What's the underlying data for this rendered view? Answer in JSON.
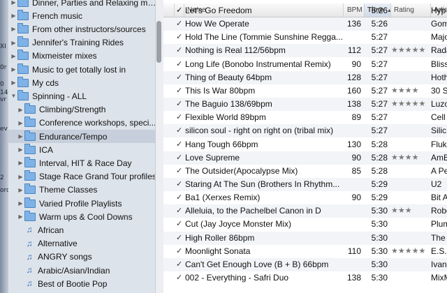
{
  "bg_fragments": [
    "XI",
    "0r",
    "0",
    "14",
    "vr",
    "ev",
    "2",
    "ord"
  ],
  "sidebar": {
    "items": [
      {
        "label": "Dinner, Parties and Relaxing music",
        "kind": "folder",
        "indent": 0,
        "disclosure": "▶",
        "selected": false
      },
      {
        "label": "French music",
        "kind": "folder",
        "indent": 0,
        "disclosure": "▶",
        "selected": false
      },
      {
        "label": "From other instructors/sources",
        "kind": "folder",
        "indent": 0,
        "disclosure": "▶",
        "selected": false
      },
      {
        "label": "Jennifer's Training Rides",
        "kind": "folder",
        "indent": 0,
        "disclosure": "▶",
        "selected": false
      },
      {
        "label": "Mixmeister mixes",
        "kind": "folder",
        "indent": 0,
        "disclosure": "▶",
        "selected": false
      },
      {
        "label": "Music to get totally lost in",
        "kind": "folder",
        "indent": 0,
        "disclosure": "▶",
        "selected": false
      },
      {
        "label": "My cds",
        "kind": "folder",
        "indent": 0,
        "disclosure": "▶",
        "selected": false
      },
      {
        "label": "Spinning - ALL",
        "kind": "folder",
        "indent": 0,
        "disclosure": "▼",
        "selected": false
      },
      {
        "label": "Climbing/Strength",
        "kind": "folder",
        "indent": 1,
        "disclosure": "▶",
        "selected": false
      },
      {
        "label": "Conference workshops, speci...",
        "kind": "folder",
        "indent": 1,
        "disclosure": "▶",
        "selected": false
      },
      {
        "label": "Endurance/Tempo",
        "kind": "folder",
        "indent": 1,
        "disclosure": "▶",
        "selected": true
      },
      {
        "label": "ICA",
        "kind": "folder",
        "indent": 1,
        "disclosure": "▶",
        "selected": false
      },
      {
        "label": "Interval, HIT & Race Day",
        "kind": "folder",
        "indent": 1,
        "disclosure": "▶",
        "selected": false
      },
      {
        "label": "Stage Race Grand Tour profiles",
        "kind": "folder",
        "indent": 1,
        "disclosure": "▶",
        "selected": false
      },
      {
        "label": "Theme Classes",
        "kind": "folder",
        "indent": 1,
        "disclosure": "▶",
        "selected": false
      },
      {
        "label": "Varied Profile Playlists",
        "kind": "folder",
        "indent": 1,
        "disclosure": "▶",
        "selected": false
      },
      {
        "label": "Warm ups & Cool Downs",
        "kind": "folder",
        "indent": 1,
        "disclosure": "▶",
        "selected": false
      },
      {
        "label": "African",
        "kind": "playlist",
        "indent": 1,
        "disclosure": "",
        "selected": false
      },
      {
        "label": "Alternative",
        "kind": "playlist",
        "indent": 1,
        "disclosure": "",
        "selected": false
      },
      {
        "label": "ANGRY songs",
        "kind": "playlist",
        "indent": 1,
        "disclosure": "",
        "selected": false
      },
      {
        "label": "Arabic/Asian/Indian",
        "kind": "playlist",
        "indent": 1,
        "disclosure": "",
        "selected": false
      },
      {
        "label": "Best of Bootie Pop",
        "kind": "playlist",
        "indent": 1,
        "disclosure": "",
        "selected": false
      }
    ]
  },
  "table": {
    "headers": {
      "check": "✓",
      "name": "Name",
      "bpm": "BPM",
      "time": "Time",
      "sort_indicator": "▲",
      "rating": "Rating",
      "artist": "Artist"
    },
    "rows": [
      {
        "check": "✓",
        "name": "Let's Go Freedom",
        "bpm": "",
        "time": "5:26",
        "rating": "",
        "artist": "Hyp"
      },
      {
        "check": "✓",
        "name": "How We Operate",
        "bpm": "136",
        "time": "5:26",
        "rating": "",
        "artist": "Gom"
      },
      {
        "check": "✓",
        "name": "Hold The Line (Tommie Sunshine Regga...",
        "bpm": "",
        "time": "5:27",
        "rating": "",
        "artist": "Majo"
      },
      {
        "check": "✓",
        "name": "Nothing is Real 112/56bpm",
        "bpm": "112",
        "time": "5:27",
        "rating": "★★★★★",
        "artist": "Rada"
      },
      {
        "check": "✓",
        "name": "Long Life (Bonobo Instrumental Remix)",
        "bpm": "90",
        "time": "5:27",
        "rating": "",
        "artist": "Bliss"
      },
      {
        "check": "✓",
        "name": "Thing of Beauty 64bpm",
        "bpm": "128",
        "time": "5:27",
        "rating": "",
        "artist": "Hoth"
      },
      {
        "check": "✓",
        "name": "This Is War 80bpm",
        "bpm": "160",
        "time": "5:27",
        "rating": "★★★★",
        "artist": "30 S"
      },
      {
        "check": "✓",
        "name": "The Baguio 138/69bpm",
        "bpm": "138",
        "time": "5:27",
        "rating": "★★★★★",
        "artist": "Luzo"
      },
      {
        "check": "✓",
        "name": "Flexible World 89bpm",
        "bpm": "89",
        "time": "5:27",
        "rating": "",
        "artist": "Cell"
      },
      {
        "check": "✓",
        "name": "silicon soul - right on right on (tribal mix)",
        "bpm": "",
        "time": "5:27",
        "rating": "",
        "artist": "Silic"
      },
      {
        "check": "✓",
        "name": "Hang Tough 66bpm",
        "bpm": "130",
        "time": "5:28",
        "rating": "",
        "artist": "Fluke"
      },
      {
        "check": "✓",
        "name": "Love Supreme",
        "bpm": "90",
        "time": "5:28",
        "rating": "★★★★",
        "artist": "AmB"
      },
      {
        "check": "✓",
        "name": "The Outsider(Apocalypse Mix)",
        "bpm": "85",
        "time": "5:28",
        "rating": "",
        "artist": "A Pe"
      },
      {
        "check": "✓",
        "name": "Staring At The Sun (Brothers In Rhythm...",
        "bpm": "",
        "time": "5:29",
        "rating": "",
        "artist": "U2"
      },
      {
        "check": "✓",
        "name": "Ba1 (Xerxes Remix)",
        "bpm": "90",
        "time": "5:29",
        "rating": "",
        "artist": "Bit A"
      },
      {
        "check": "✓",
        "name": "Alleluia, to the Pachelbel Canon in D",
        "bpm": "",
        "time": "5:30",
        "rating": "★★★",
        "artist": "Robe"
      },
      {
        "check": "✓",
        "name": "Cut (Jay Joyce Monster Mix)",
        "bpm": "",
        "time": "5:30",
        "rating": "",
        "artist": "Plum"
      },
      {
        "check": "✓",
        "name": "High Roller 86bpm",
        "bpm": "",
        "time": "5:30",
        "rating": "",
        "artist": "The C"
      },
      {
        "check": "✓",
        "name": "Moonlight Sonata",
        "bpm": "110",
        "time": "5:30",
        "rating": "★★★★★",
        "artist": "E.S."
      },
      {
        "check": "✓",
        "name": "Can't Get Enough Love (B + B) 66bpm",
        "bpm": "",
        "time": "5:30",
        "rating": "",
        "artist": "Ivano"
      },
      {
        "check": "✓",
        "name": "002 - Everything - Safri Duo",
        "bpm": "138",
        "time": "5:30",
        "rating": "",
        "artist": "MixM"
      }
    ]
  }
}
